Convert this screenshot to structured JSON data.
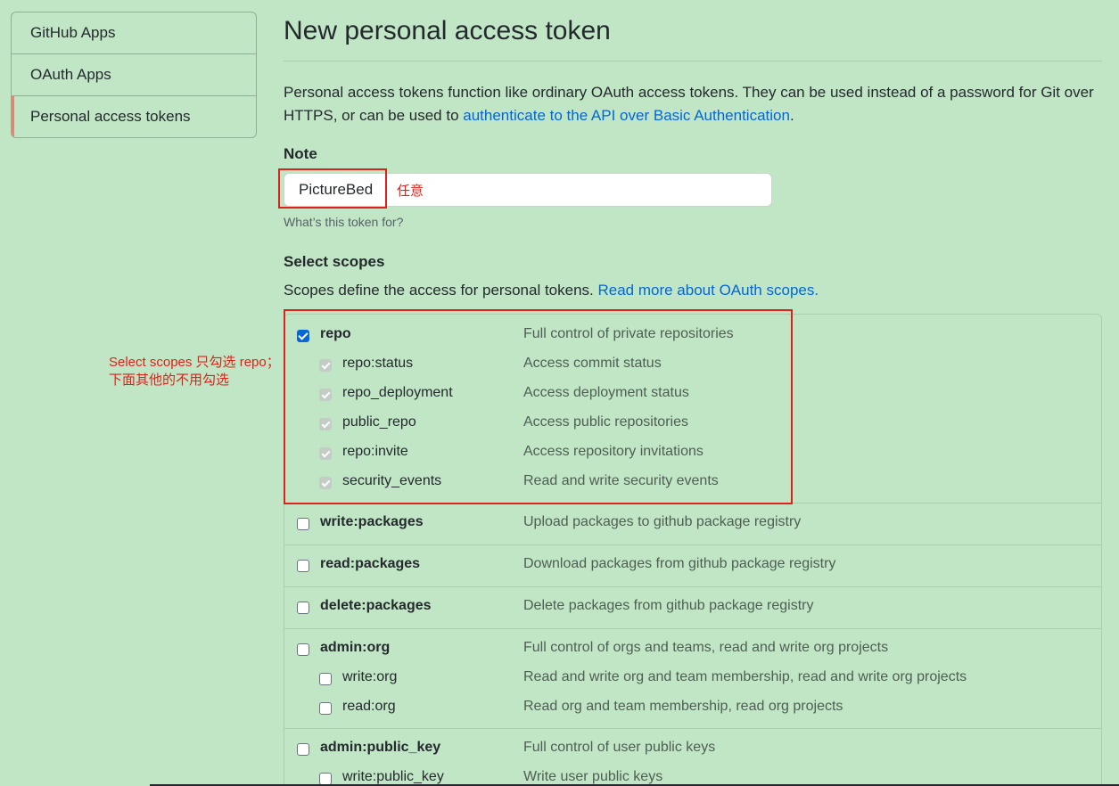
{
  "sidebar": {
    "items": [
      {
        "label": "GitHub Apps"
      },
      {
        "label": "OAuth Apps"
      },
      {
        "label": "Personal access tokens"
      }
    ]
  },
  "header": {
    "title": "New personal access token"
  },
  "description": {
    "text_before": "Personal access tokens function like ordinary OAuth access tokens. They can be used instead of a password for Git over HTTPS, or can be used to ",
    "link": "authenticate to the API over Basic Authentication",
    "text_after": "."
  },
  "note": {
    "label": "Note",
    "value": "PictureBed",
    "annotation": "任意",
    "help": "What’s this token for?"
  },
  "scopes": {
    "title": "Select scopes",
    "desc_text": "Scopes define the access for personal tokens. ",
    "desc_link": "Read more about OAuth scopes.",
    "annotation_line1": "Select scopes 只勾选 repo；",
    "annotation_line2": "下面其他的不用勾选",
    "repo": {
      "name": "repo",
      "desc": "Full control of private repositories",
      "children": [
        {
          "name": "repo:status",
          "desc": "Access commit status"
        },
        {
          "name": "repo_deployment",
          "desc": "Access deployment status"
        },
        {
          "name": "public_repo",
          "desc": "Access public repositories"
        },
        {
          "name": "repo:invite",
          "desc": "Access repository invitations"
        },
        {
          "name": "security_events",
          "desc": "Read and write security events"
        }
      ]
    },
    "write_packages": {
      "name": "write:packages",
      "desc": "Upload packages to github package registry"
    },
    "read_packages": {
      "name": "read:packages",
      "desc": "Download packages from github package registry"
    },
    "delete_packages": {
      "name": "delete:packages",
      "desc": "Delete packages from github package registry"
    },
    "admin_org": {
      "name": "admin:org",
      "desc": "Full control of orgs and teams, read and write org projects",
      "children": [
        {
          "name": "write:org",
          "desc": "Read and write org and team membership, read and write org projects"
        },
        {
          "name": "read:org",
          "desc": "Read org and team membership, read org projects"
        }
      ]
    },
    "admin_public_key": {
      "name": "admin:public_key",
      "desc": "Full control of user public keys",
      "children": [
        {
          "name": "write:public_key",
          "desc": "Write user public keys"
        }
      ]
    }
  },
  "colors": {
    "background": "#c1e6c5",
    "link": "#0366d6",
    "annotation": "#e0201b",
    "checkbox_checked": "#0a66d6",
    "active_indicator": "#e9826e"
  }
}
